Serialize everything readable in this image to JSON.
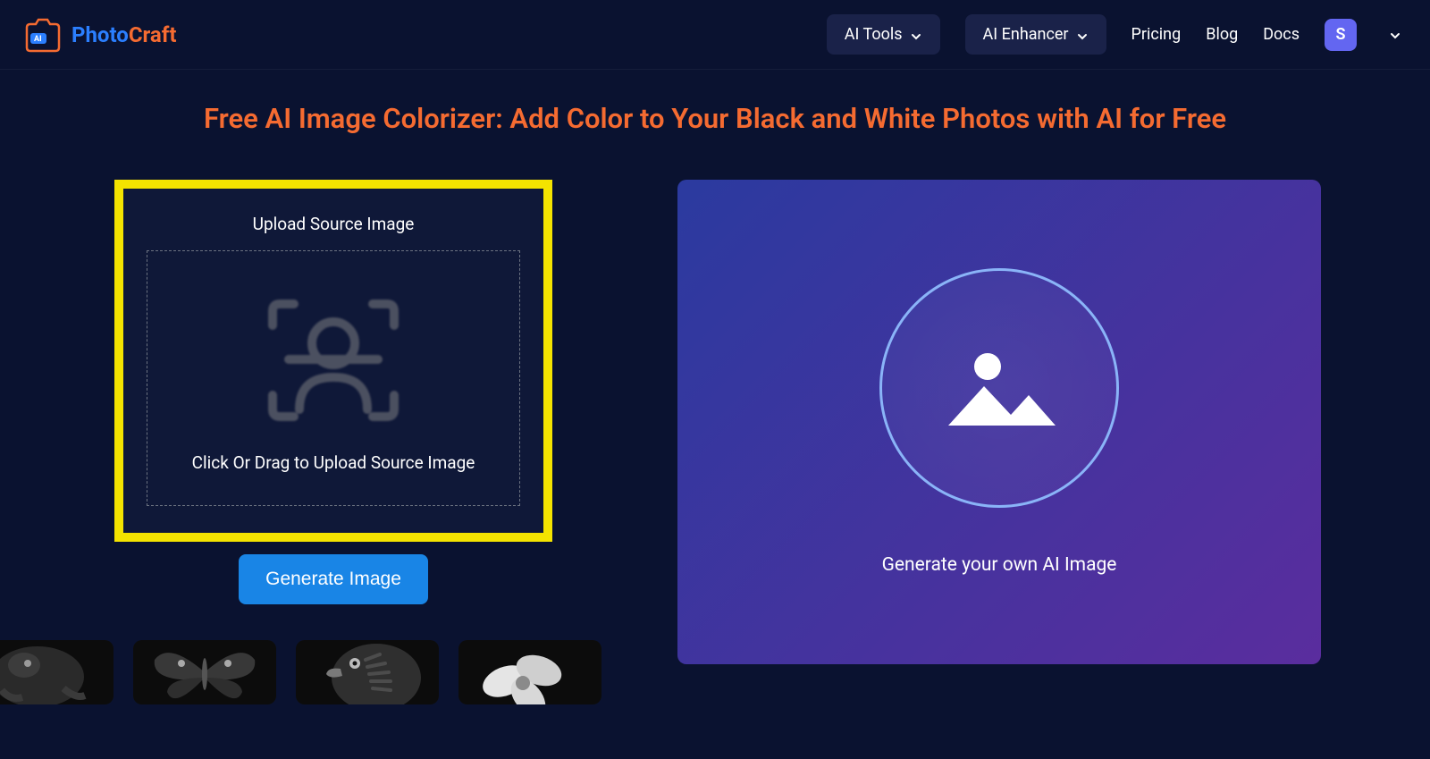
{
  "header": {
    "logo": {
      "photo": "Photo",
      "craft": "Craft",
      "ai_badge": "AI"
    },
    "nav": {
      "ai_tools": "AI Tools",
      "ai_enhancer": "AI Enhancer",
      "pricing": "Pricing",
      "blog": "Blog",
      "docs": "Docs"
    },
    "avatar_initial": "S"
  },
  "page": {
    "title": "Free AI Image Colorizer: Add Color to Your Black and White Photos with AI for Free"
  },
  "upload": {
    "title": "Upload Source Image",
    "dropzone_text": "Click Or Drag to Upload Source Image",
    "generate_button": "Generate Image"
  },
  "preview": {
    "caption": "Generate your own AI Image"
  },
  "thumbnails": [
    {
      "alt": "lizard-bw"
    },
    {
      "alt": "butterfly-bw"
    },
    {
      "alt": "eagle-bw"
    },
    {
      "alt": "flower-bw"
    }
  ],
  "colors": {
    "accent_orange": "#f56b31",
    "accent_blue": "#1985e6",
    "highlight_yellow": "#f4e300",
    "bg_dark": "#0a1230"
  }
}
